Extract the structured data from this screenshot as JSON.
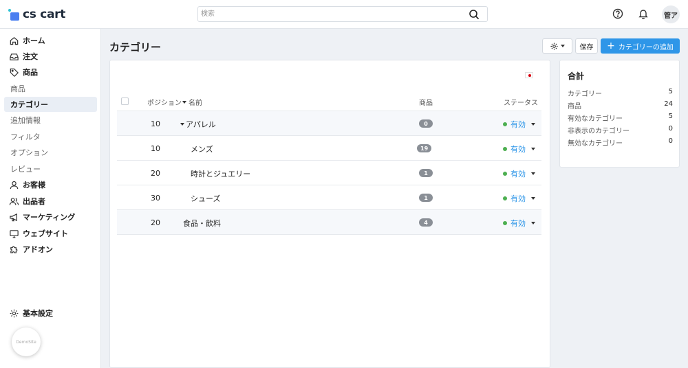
{
  "app": {
    "logo_text": "cs cart",
    "avatar_initials": "管ア"
  },
  "search": {
    "placeholder": "検索"
  },
  "sidebar": {
    "items": [
      {
        "label": "ホーム",
        "icon": "home-icon"
      },
      {
        "label": "注文",
        "icon": "inbox-icon"
      },
      {
        "label": "商品",
        "icon": "tag-icon"
      },
      {
        "label": "商品"
      },
      {
        "label": "カテゴリー"
      },
      {
        "label": "追加情報"
      },
      {
        "label": "フィルタ"
      },
      {
        "label": "オプション"
      },
      {
        "label": "レビュー"
      },
      {
        "label": "お客様",
        "icon": "user-icon"
      },
      {
        "label": "出品者",
        "icon": "users-icon"
      },
      {
        "label": "マーケティング",
        "icon": "megaphone-icon"
      },
      {
        "label": "ウェブサイト",
        "icon": "monitor-icon"
      },
      {
        "label": "アドオン",
        "icon": "puzzle-icon"
      }
    ],
    "settings_label": "基本設定",
    "demo_label": "DemoSite"
  },
  "header": {
    "title": "カテゴリー",
    "save_label": "保存",
    "add_label": "カテゴリーの追加"
  },
  "table": {
    "columns": {
      "position": "ポジション",
      "name": "名前",
      "products": "商品",
      "status": "ステータス"
    },
    "rows": [
      {
        "position": "10",
        "name": "アパレル",
        "products": "0",
        "status": "有効"
      },
      {
        "position": "10",
        "name": "メンズ",
        "products": "19",
        "status": "有効"
      },
      {
        "position": "20",
        "name": "時計とジュエリー",
        "products": "1",
        "status": "有効"
      },
      {
        "position": "30",
        "name": "シューズ",
        "products": "1",
        "status": "有効"
      },
      {
        "position": "20",
        "name": "食品・飲料",
        "products": "4",
        "status": "有効"
      }
    ]
  },
  "summary": {
    "title": "合計",
    "rows": [
      {
        "label": "カテゴリー",
        "value": "5"
      },
      {
        "label": "商品",
        "value": "24"
      },
      {
        "label": "有効なカテゴリー",
        "value": "5"
      },
      {
        "label": "非表示のカテゴリー",
        "value": "0"
      },
      {
        "label": "無効なカテゴリー",
        "value": "0"
      }
    ]
  },
  "colors": {
    "accent": "#2e96e8",
    "active_status": "#4caf50",
    "badge": "#8a8f96"
  }
}
